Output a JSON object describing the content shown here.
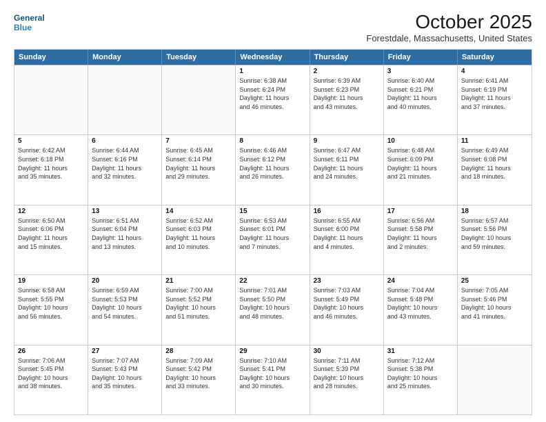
{
  "header": {
    "logo_line1": "General",
    "logo_line2": "Blue",
    "month_title": "October 2025",
    "subtitle": "Forestdale, Massachusetts, United States"
  },
  "days_of_week": [
    "Sunday",
    "Monday",
    "Tuesday",
    "Wednesday",
    "Thursday",
    "Friday",
    "Saturday"
  ],
  "weeks": [
    [
      {
        "day": "",
        "info": ""
      },
      {
        "day": "",
        "info": ""
      },
      {
        "day": "",
        "info": ""
      },
      {
        "day": "1",
        "info": "Sunrise: 6:38 AM\nSunset: 6:24 PM\nDaylight: 11 hours\nand 46 minutes."
      },
      {
        "day": "2",
        "info": "Sunrise: 6:39 AM\nSunset: 6:23 PM\nDaylight: 11 hours\nand 43 minutes."
      },
      {
        "day": "3",
        "info": "Sunrise: 6:40 AM\nSunset: 6:21 PM\nDaylight: 11 hours\nand 40 minutes."
      },
      {
        "day": "4",
        "info": "Sunrise: 6:41 AM\nSunset: 6:19 PM\nDaylight: 11 hours\nand 37 minutes."
      }
    ],
    [
      {
        "day": "5",
        "info": "Sunrise: 6:42 AM\nSunset: 6:18 PM\nDaylight: 11 hours\nand 35 minutes."
      },
      {
        "day": "6",
        "info": "Sunrise: 6:44 AM\nSunset: 6:16 PM\nDaylight: 11 hours\nand 32 minutes."
      },
      {
        "day": "7",
        "info": "Sunrise: 6:45 AM\nSunset: 6:14 PM\nDaylight: 11 hours\nand 29 minutes."
      },
      {
        "day": "8",
        "info": "Sunrise: 6:46 AM\nSunset: 6:12 PM\nDaylight: 11 hours\nand 26 minutes."
      },
      {
        "day": "9",
        "info": "Sunrise: 6:47 AM\nSunset: 6:11 PM\nDaylight: 11 hours\nand 24 minutes."
      },
      {
        "day": "10",
        "info": "Sunrise: 6:48 AM\nSunset: 6:09 PM\nDaylight: 11 hours\nand 21 minutes."
      },
      {
        "day": "11",
        "info": "Sunrise: 6:49 AM\nSunset: 6:08 PM\nDaylight: 11 hours\nand 18 minutes."
      }
    ],
    [
      {
        "day": "12",
        "info": "Sunrise: 6:50 AM\nSunset: 6:06 PM\nDaylight: 11 hours\nand 15 minutes."
      },
      {
        "day": "13",
        "info": "Sunrise: 6:51 AM\nSunset: 6:04 PM\nDaylight: 11 hours\nand 13 minutes."
      },
      {
        "day": "14",
        "info": "Sunrise: 6:52 AM\nSunset: 6:03 PM\nDaylight: 11 hours\nand 10 minutes."
      },
      {
        "day": "15",
        "info": "Sunrise: 6:53 AM\nSunset: 6:01 PM\nDaylight: 11 hours\nand 7 minutes."
      },
      {
        "day": "16",
        "info": "Sunrise: 6:55 AM\nSunset: 6:00 PM\nDaylight: 11 hours\nand 4 minutes."
      },
      {
        "day": "17",
        "info": "Sunrise: 6:56 AM\nSunset: 5:58 PM\nDaylight: 11 hours\nand 2 minutes."
      },
      {
        "day": "18",
        "info": "Sunrise: 6:57 AM\nSunset: 5:56 PM\nDaylight: 10 hours\nand 59 minutes."
      }
    ],
    [
      {
        "day": "19",
        "info": "Sunrise: 6:58 AM\nSunset: 5:55 PM\nDaylight: 10 hours\nand 56 minutes."
      },
      {
        "day": "20",
        "info": "Sunrise: 6:59 AM\nSunset: 5:53 PM\nDaylight: 10 hours\nand 54 minutes."
      },
      {
        "day": "21",
        "info": "Sunrise: 7:00 AM\nSunset: 5:52 PM\nDaylight: 10 hours\nand 51 minutes."
      },
      {
        "day": "22",
        "info": "Sunrise: 7:01 AM\nSunset: 5:50 PM\nDaylight: 10 hours\nand 48 minutes."
      },
      {
        "day": "23",
        "info": "Sunrise: 7:03 AM\nSunset: 5:49 PM\nDaylight: 10 hours\nand 46 minutes."
      },
      {
        "day": "24",
        "info": "Sunrise: 7:04 AM\nSunset: 5:48 PM\nDaylight: 10 hours\nand 43 minutes."
      },
      {
        "day": "25",
        "info": "Sunrise: 7:05 AM\nSunset: 5:46 PM\nDaylight: 10 hours\nand 41 minutes."
      }
    ],
    [
      {
        "day": "26",
        "info": "Sunrise: 7:06 AM\nSunset: 5:45 PM\nDaylight: 10 hours\nand 38 minutes."
      },
      {
        "day": "27",
        "info": "Sunrise: 7:07 AM\nSunset: 5:43 PM\nDaylight: 10 hours\nand 35 minutes."
      },
      {
        "day": "28",
        "info": "Sunrise: 7:09 AM\nSunset: 5:42 PM\nDaylight: 10 hours\nand 33 minutes."
      },
      {
        "day": "29",
        "info": "Sunrise: 7:10 AM\nSunset: 5:41 PM\nDaylight: 10 hours\nand 30 minutes."
      },
      {
        "day": "30",
        "info": "Sunrise: 7:11 AM\nSunset: 5:39 PM\nDaylight: 10 hours\nand 28 minutes."
      },
      {
        "day": "31",
        "info": "Sunrise: 7:12 AM\nSunset: 5:38 PM\nDaylight: 10 hours\nand 25 minutes."
      },
      {
        "day": "",
        "info": ""
      }
    ]
  ]
}
